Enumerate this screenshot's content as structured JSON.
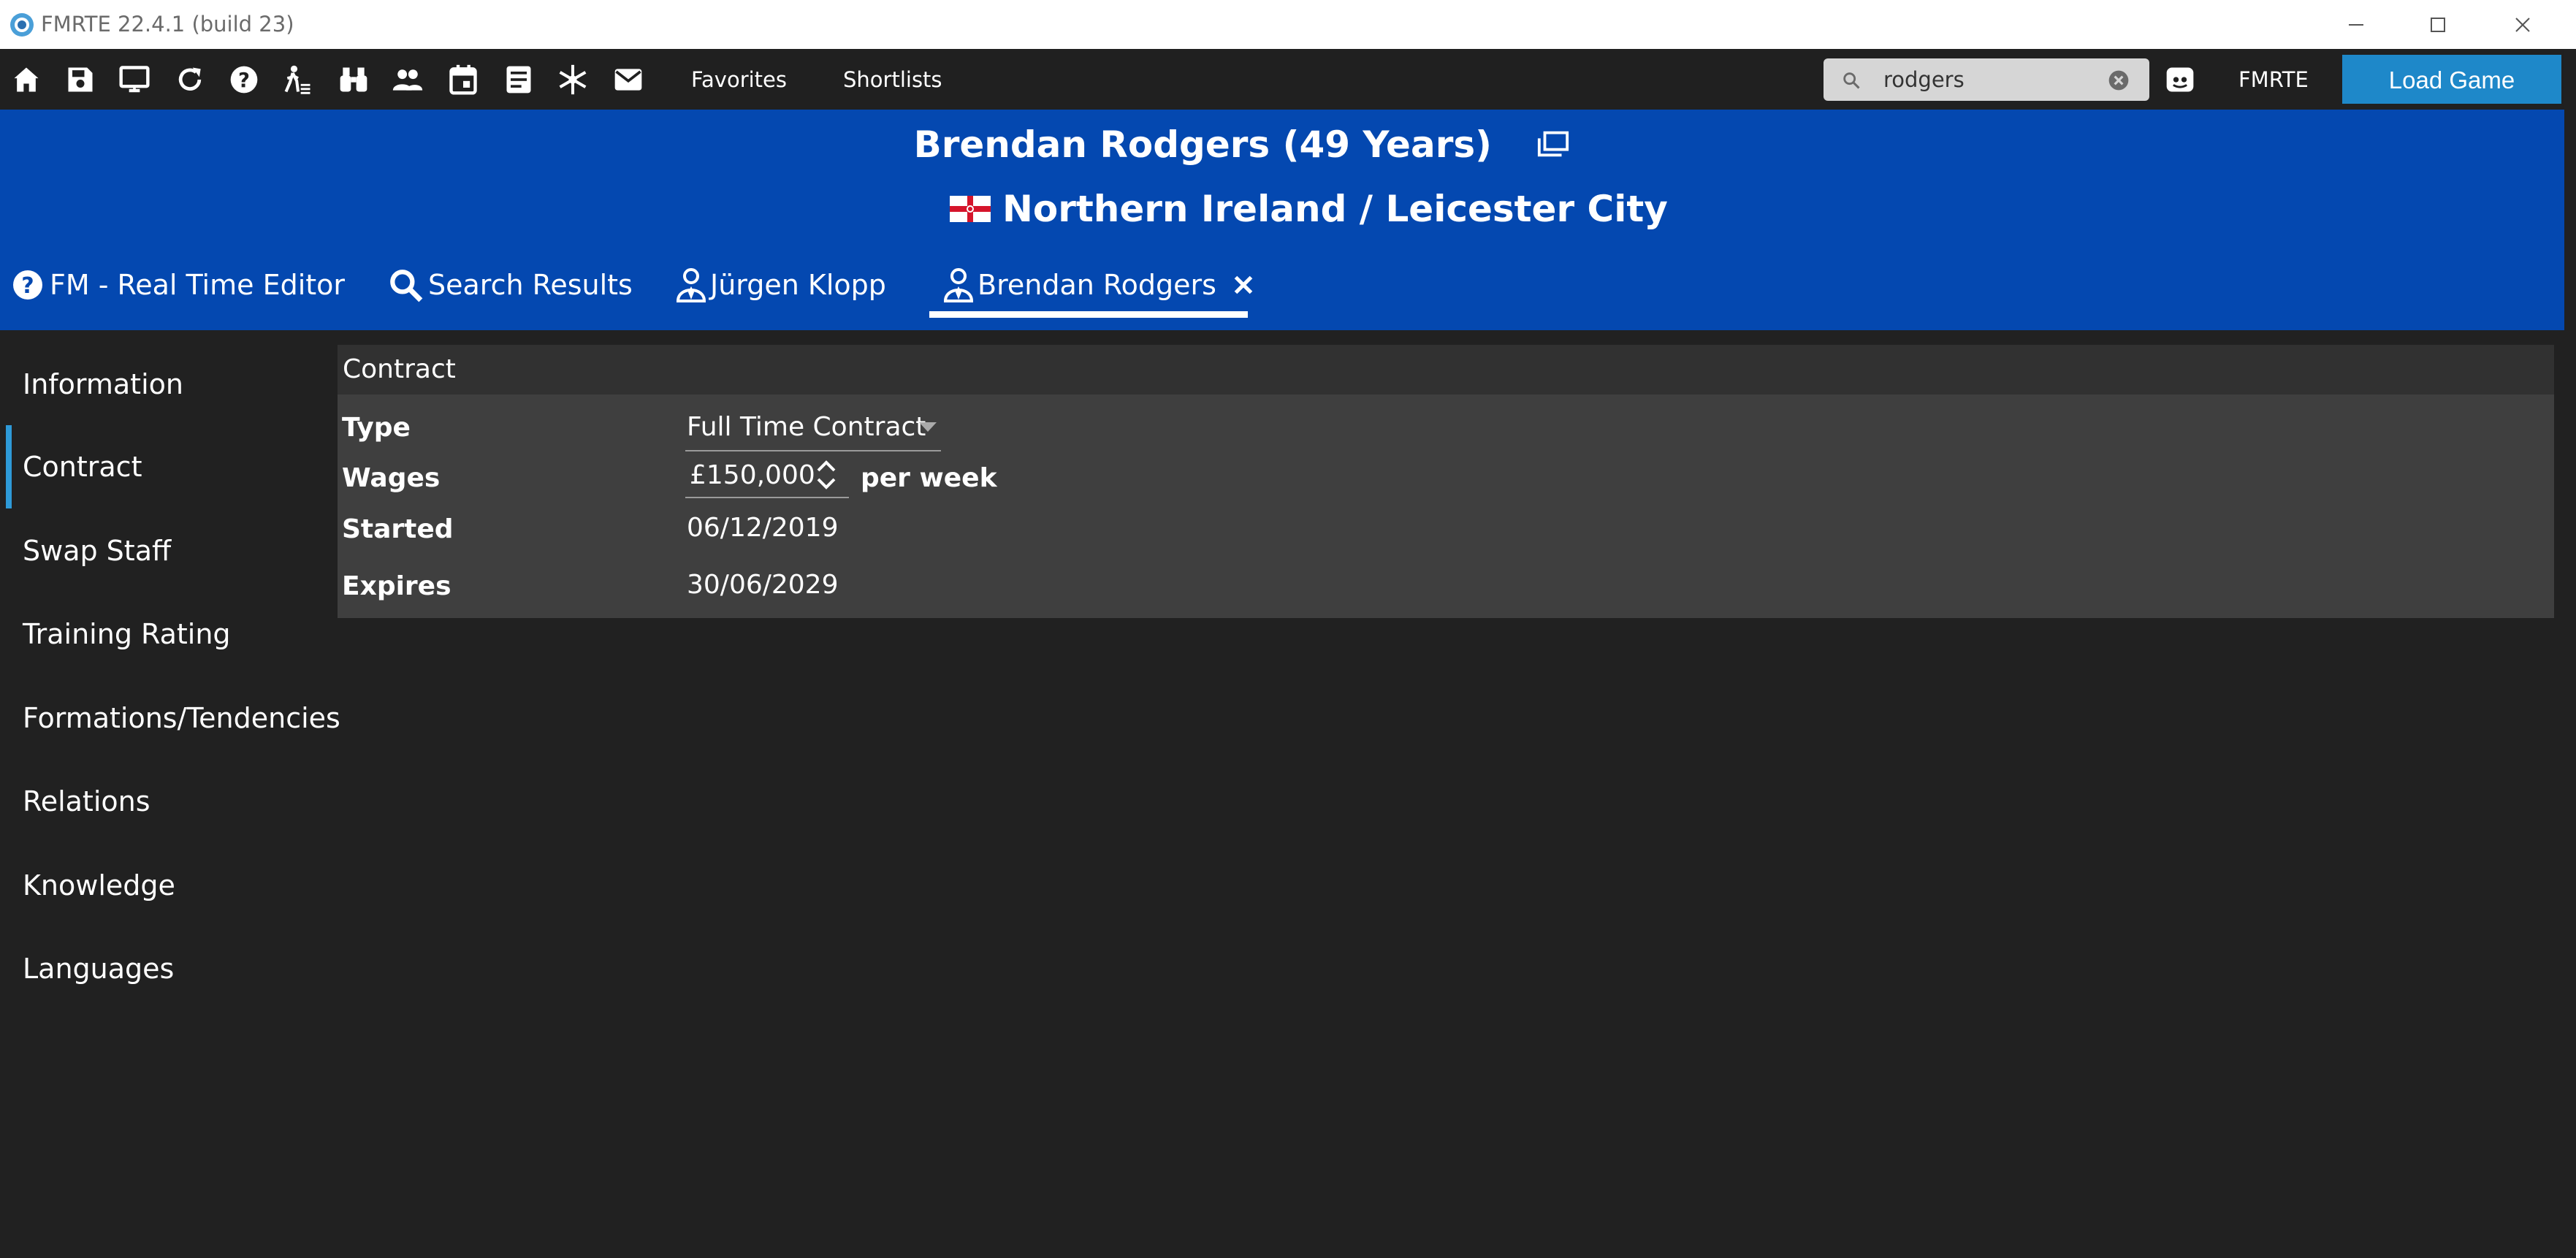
{
  "window": {
    "title": "FMRTE 22.4.1 (build 23)"
  },
  "toolbar": {
    "icons": [
      "home-icon",
      "save-icon",
      "monitor-icon",
      "refresh-icon",
      "help-icon",
      "transfer-icon",
      "binoculars-icon",
      "people-icon",
      "calendar-icon",
      "notes-icon",
      "snowflake-icon",
      "mail-icon"
    ],
    "favorites": "Favorites",
    "shortlists": "Shortlists",
    "search": {
      "value": "rodgers",
      "placeholder": ""
    },
    "brand": "FMRTE",
    "load_game": "Load Game"
  },
  "header": {
    "title": "Brendan Rodgers (49 Years)",
    "subtitle": "Northern Ireland / Leicester City",
    "tabs": [
      {
        "label": "FM - Real Time Editor",
        "icon": "help-circle-icon"
      },
      {
        "label": "Search Results",
        "icon": "search-icon"
      },
      {
        "label": "Jürgen Klopp",
        "icon": "person-icon"
      },
      {
        "label": "Brendan Rodgers",
        "icon": "person-icon",
        "active": true
      }
    ]
  },
  "sidebar": {
    "items": [
      {
        "label": "Information"
      },
      {
        "label": "Contract",
        "active": true
      },
      {
        "label": "Swap Staff"
      },
      {
        "label": "Training Rating"
      },
      {
        "label": "Formations/Tendencies"
      },
      {
        "label": "Relations"
      },
      {
        "label": "Knowledge"
      },
      {
        "label": "Languages"
      }
    ]
  },
  "contract": {
    "heading": "Contract",
    "type_label": "Type",
    "type_value": "Full Time Contract",
    "wages_label": "Wages",
    "wages_value": "£150,000",
    "wages_unit": "per week",
    "started_label": "Started",
    "started_value": "06/12/2019",
    "expires_label": "Expires",
    "expires_value": "30/06/2029"
  },
  "colors": {
    "header_blue": "#0448b0",
    "accent": "#1e88c9",
    "background": "#212121",
    "panel": "#3f3f3f"
  }
}
